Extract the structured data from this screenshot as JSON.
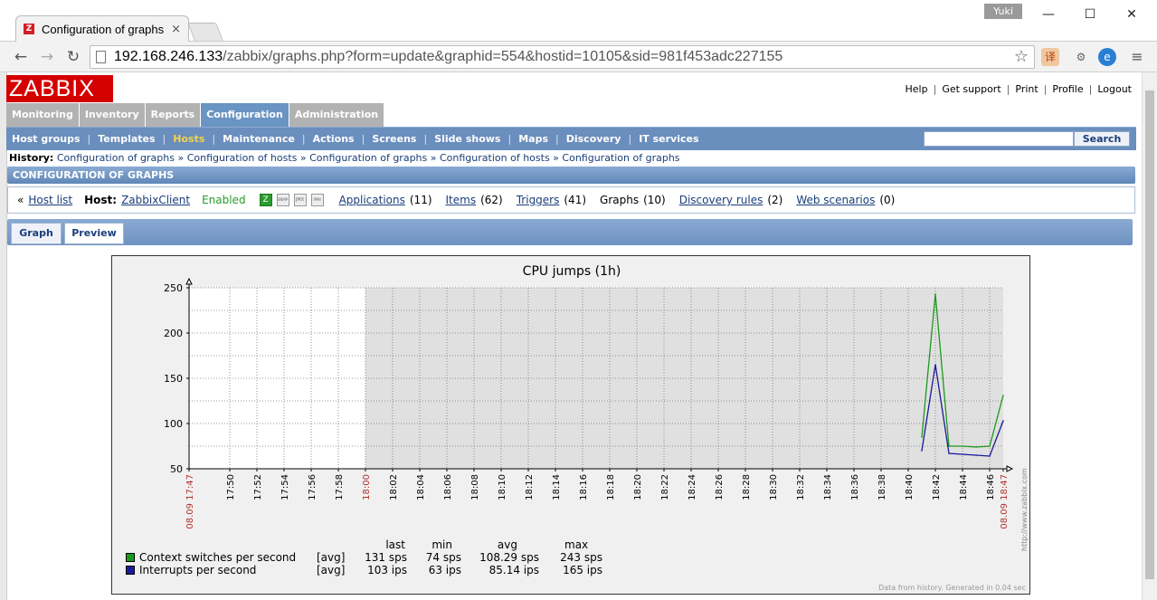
{
  "browser": {
    "tab_title": "Configuration of graphs",
    "tab_close": "×",
    "user_badge": "Yuki",
    "url_host": "192.168.246.133",
    "url_path": "/zabbix/graphs.php?form=update&graphid=554&hostid=10105&sid=981f453adc227155"
  },
  "toplinks": [
    "Help",
    "Get support",
    "Print",
    "Profile",
    "Logout"
  ],
  "logo": "ZABBIX",
  "mainmenu": [
    "Monitoring",
    "Inventory",
    "Reports",
    "Configuration",
    "Administration"
  ],
  "submenu": [
    "Host groups",
    "Templates",
    "Hosts",
    "Maintenance",
    "Actions",
    "Screens",
    "Slide shows",
    "Maps",
    "Discovery",
    "IT services"
  ],
  "search_button": "Search",
  "history": {
    "label": "History:",
    "items": [
      "Configuration of graphs",
      "Configuration of hosts",
      "Configuration of graphs",
      "Configuration of hosts",
      "Configuration of graphs"
    ]
  },
  "section_title": "CONFIGURATION OF GRAPHS",
  "hostbar": {
    "back": "«",
    "host_list": "Host list",
    "host_label": "Host:",
    "host_name": "ZabbixClient",
    "status": "Enabled",
    "badges": [
      "Z",
      "SNMP",
      "JMX",
      "IPMI"
    ],
    "applications": "Applications",
    "applications_count": "(11)",
    "items": "Items",
    "items_count": "(62)",
    "triggers": "Triggers",
    "triggers_count": "(41)",
    "graphs": "Graphs",
    "graphs_count": "(10)",
    "discovery": "Discovery rules",
    "discovery_count": "(2)",
    "web": "Web scenarios",
    "web_count": "(0)"
  },
  "tabs": [
    "Graph",
    "Preview"
  ],
  "chart_data": {
    "type": "line",
    "title": "CPU jumps (1h)",
    "ylim": [
      50,
      250
    ],
    "yticks": [
      50,
      100,
      150,
      200,
      250
    ],
    "xticks": [
      "17:50",
      "17:52",
      "17:54",
      "17:56",
      "17:58",
      "18:00",
      "18:02",
      "18:04",
      "18:06",
      "18:08",
      "18:10",
      "18:12",
      "18:14",
      "18:16",
      "18:18",
      "18:20",
      "18:22",
      "18:24",
      "18:26",
      "18:28",
      "18:30",
      "18:32",
      "18:34",
      "18:36",
      "18:38",
      "18:40",
      "18:42",
      "18:44",
      "18:46"
    ],
    "x_start_label": "08.09 17:47",
    "x_end_label": "08.09 18:47",
    "no_data_before": "18:00",
    "series": [
      {
        "name": "Context switches per second",
        "color": "#1a9a1a",
        "x": [
          "18:41",
          "18:42",
          "18:43",
          "18:44",
          "18:45",
          "18:46",
          "18:47"
        ],
        "values": [
          85,
          243,
          75,
          75,
          74,
          75,
          131
        ],
        "func": "[avg]",
        "last": "131 sps",
        "min": "74 sps",
        "avg": "108.29 sps",
        "max": "243 sps"
      },
      {
        "name": "Interrupts per second",
        "color": "#1a1a9a",
        "x": [
          "18:41",
          "18:42",
          "18:43",
          "18:44",
          "18:45",
          "18:46",
          "18:47"
        ],
        "values": [
          70,
          165,
          67,
          66,
          65,
          64,
          103
        ],
        "func": "[avg]",
        "last": "103 ips",
        "min": "63 ips",
        "avg": "85.14 ips",
        "max": "165 ips"
      }
    ],
    "legend_headers": [
      "last",
      "min",
      "avg",
      "max"
    ],
    "footer": "Data from history. Generated in 0.04 sec",
    "watermark": "http://www.zabbix.com"
  }
}
